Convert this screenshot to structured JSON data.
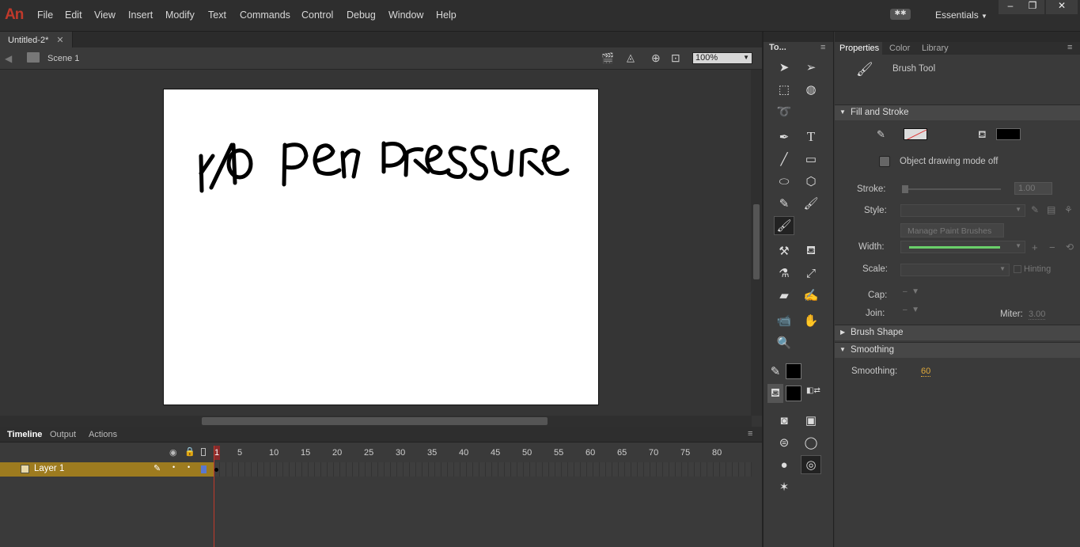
{
  "app": {
    "logo": "An",
    "workspace": "Essentials"
  },
  "menu": [
    "File",
    "Edit",
    "View",
    "Insert",
    "Modify",
    "Text",
    "Commands",
    "Control",
    "Debug",
    "Window",
    "Help"
  ],
  "document": {
    "tab": "Untitled-2*",
    "scene": "Scene 1",
    "zoom": "100%"
  },
  "stage": {
    "drawing_text": "NO PeN PResSURe"
  },
  "timeline": {
    "tabs": [
      "Timeline",
      "Output",
      "Actions"
    ],
    "frame_marks": [
      "1",
      "5",
      "10",
      "15",
      "20",
      "25",
      "30",
      "35",
      "40",
      "45",
      "50",
      "55",
      "60",
      "65",
      "70",
      "75",
      "80"
    ],
    "layer": "Layer 1"
  },
  "tools": {
    "title": "To..."
  },
  "properties": {
    "tabs": [
      "Properties",
      "Color",
      "Library"
    ],
    "tool_name": "Brush Tool",
    "fill_stroke": "Fill and Stroke",
    "object_drawing": "Object drawing mode off",
    "stroke_label": "Stroke:",
    "stroke_value": "1.00",
    "style_label": "Style:",
    "manage_brushes": "Manage Paint Brushes",
    "width_label": "Width:",
    "scale_label": "Scale:",
    "hinting": "Hinting",
    "cap_label": "Cap:",
    "join_label": "Join:",
    "miter_label": "Miter:",
    "miter_value": "3.00",
    "brush_shape": "Brush Shape",
    "smoothing_section": "Smoothing",
    "smoothing_label": "Smoothing:",
    "smoothing_value": "60"
  },
  "colors": {
    "accent": "#9d7b1f",
    "stroke_fill": "#000000",
    "playhead": "#c0392b"
  }
}
